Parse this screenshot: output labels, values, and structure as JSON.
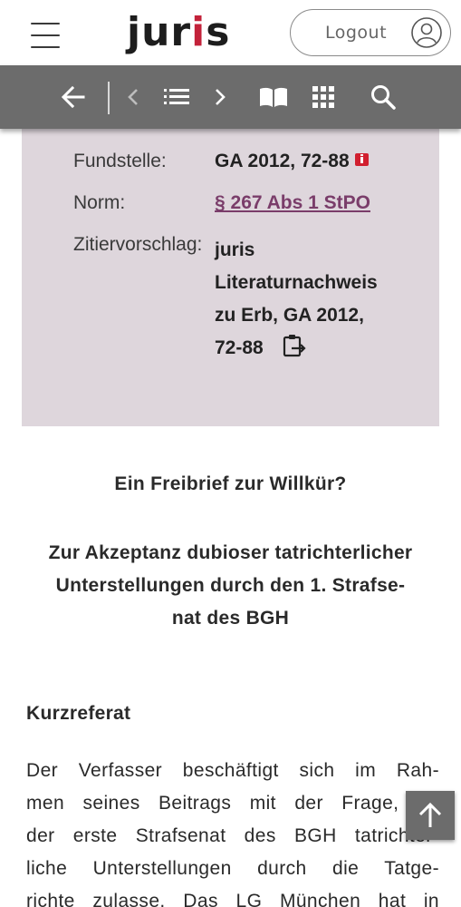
{
  "header": {
    "logo_prefix": "jur",
    "logo_accent": "i",
    "logo_suffix": "s",
    "logout_label": "Logout"
  },
  "toolbar": {
    "icons": [
      "back-arrow-icon",
      "prev-chevron-icon",
      "list-icon",
      "next-chevron-icon",
      "book-icon",
      "grid-icon",
      "search-icon"
    ]
  },
  "meta": {
    "fundstelle_label": "Fundstelle:",
    "fundstelle_value": "GA 2012, 72-88",
    "norm_label": "Norm:",
    "norm_value": "§ 267 Abs 1 StPO",
    "zitier_label": "Zitiervorschlag:",
    "zitier_lines": [
      "juris",
      "Literaturnachweis",
      "zu Erb, GA 2012,",
      "72-88"
    ]
  },
  "document": {
    "title1": "Ein Freibrief zur Willkür?",
    "title2_lines": [
      "Zur Akzeptanz dubioser tatrichterlicher",
      "Unterstellungen durch den 1. Strafse-",
      "nat des BGH"
    ],
    "section_head": "Kurzreferat",
    "body_lines": [
      "Der Verfasser beschäftigt sich im Rah-",
      "men seines Beitrags mit der Frage, ob",
      "der erste Strafsenat des BGH tatrichter-",
      "liche Unterstellungen durch die Tatge-",
      "richte zulasse. Das LG München hat in"
    ]
  },
  "colors": {
    "accent": "#c3223a",
    "toolbar": "#6c6c6c",
    "meta_box": "#ded6dc",
    "link": "#7a3d6a"
  }
}
